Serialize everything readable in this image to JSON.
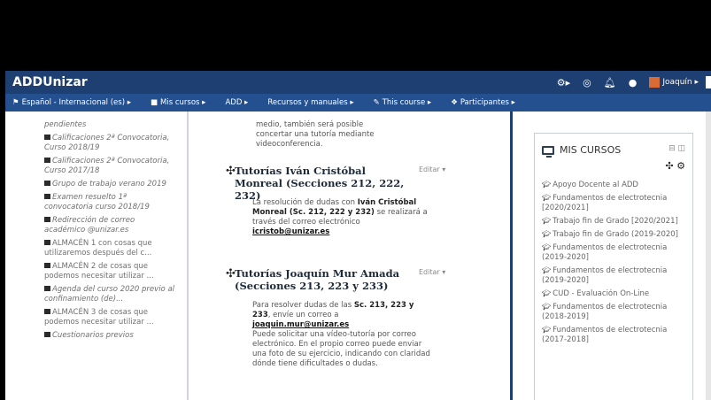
{
  "header": {
    "brand": "ADDUnizar",
    "icons": [
      "settings-icon",
      "target-icon",
      "bell-icon",
      "chat-icon"
    ],
    "user_name": "Joaquín ▸"
  },
  "nav": [
    {
      "icon": "flag-icon",
      "glyph": "⚑",
      "label": "Español - Internacional (es) ▸"
    },
    {
      "icon": "briefcase-icon",
      "glyph": "■",
      "label": "Mis cursos ▸"
    },
    {
      "icon": "",
      "glyph": "",
      "label": "ADD ▸"
    },
    {
      "icon": "",
      "glyph": "",
      "label": "Recursos y manuales ▸"
    },
    {
      "icon": "pen-icon",
      "glyph": "✎",
      "label": "This course ▸"
    },
    {
      "icon": "users-icon",
      "glyph": "❖",
      "label": "Participantes ▸"
    }
  ],
  "left_list": {
    "first": "pendientes",
    "items": [
      "Calificaciones 2ª Convocatoria, Curso 2018/19",
      "Calificaciones 2ª Convocatoria, Curso 2017/18",
      "Grupo de trabajo verano 2019",
      "Examen resuelto 1ª convocatoria curso 2018/19",
      "Redirección de correo académico @unizar.es",
      "ALMACÉN 1 con cosas que utilizaremos después del c...",
      "ALMACÉN 2 de cosas que podemos necesitar utilizar ...",
      "Agenda del curso 2020 previo al confinamiento (de)...",
      "ALMACÉN 3 de cosas que podemos necesitar utilizar ...",
      "Cuestionarios previos"
    ]
  },
  "main": {
    "top_text": "medio, también será posible concertar una tutoría mediante videoconferencia.",
    "sections": [
      {
        "title": "Tutorías Iván Cristóbal Monreal (Secciones 212, 222, 232)",
        "edit": "Editar ▾",
        "body_pre": "La resolución de dudas con ",
        "body_bold": "Iván Cristóbal Monreal (Sc. 212, 222 y 232)",
        "body_mid": " se realizará a través del correo electrónico ",
        "body_link": "icristob@unizar.es"
      },
      {
        "title": "Tutorías Joaquín Mur Amada (Secciones 213, 223 y 233)",
        "edit": "Editar ▾",
        "body_pre": "Para resolver dudas de las ",
        "body_bold": "Sc. 213, 223 y 233",
        "body_mid": ", envíe un correo a ",
        "body_link": "joaquin.mur@unizar.es",
        "body_post": "Puede solicitar una vídeo-tutoría por correo electrónico. En el propio correo puede enviar una foto de su ejercicio, indicando con claridad dónde tiene dificultades o dudas."
      }
    ]
  },
  "block": {
    "title": "MIS CURSOS",
    "courses": [
      "Apoyo Docente al ADD",
      "Fundamentos de electrotecnia [2020/2021]",
      "Trabajo fin de Grado [2020/2021]",
      "Trabajo fin de Grado (2019-2020]",
      "Fundamentos de electrotecnia (2019-2020]",
      "Fundamentos de electrotecnia (2019-2020]",
      "CUD - Evaluación On-Line",
      "Fundamentos de electrotecnia (2018-2019]",
      "Fundamentos de electrotecnia (2017-2018]"
    ]
  }
}
